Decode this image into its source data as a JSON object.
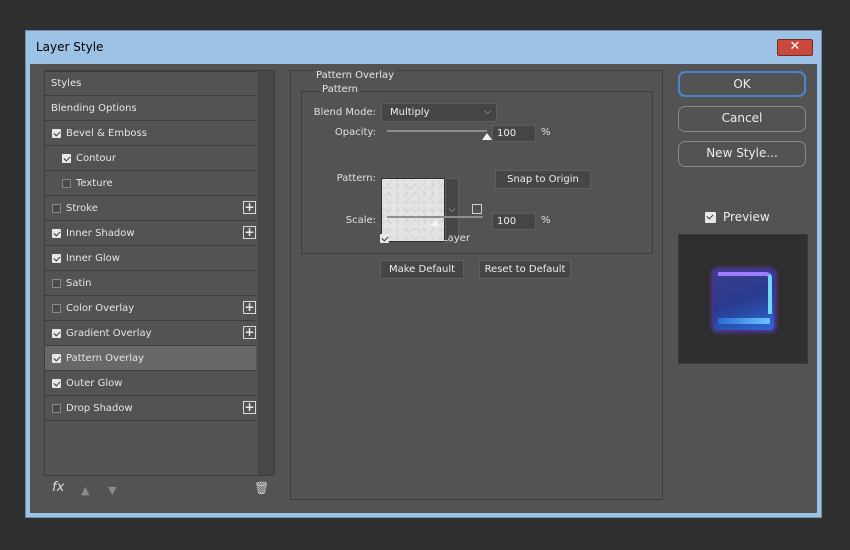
{
  "window": {
    "title": "Layer Style",
    "close_label": "✕"
  },
  "sidebar": {
    "items": [
      {
        "label": "Styles",
        "type": "header"
      },
      {
        "label": "Blending Options",
        "type": "header"
      },
      {
        "label": "Bevel & Emboss",
        "checked": true,
        "indent": 0,
        "plus": false
      },
      {
        "label": "Contour",
        "checked": true,
        "indent": 1,
        "plus": false
      },
      {
        "label": "Texture",
        "checked": false,
        "indent": 1,
        "plus": false
      },
      {
        "label": "Stroke",
        "checked": false,
        "indent": 0,
        "plus": true
      },
      {
        "label": "Inner Shadow",
        "checked": true,
        "indent": 0,
        "plus": true
      },
      {
        "label": "Inner Glow",
        "checked": true,
        "indent": 0,
        "plus": false
      },
      {
        "label": "Satin",
        "checked": false,
        "indent": 0,
        "plus": false
      },
      {
        "label": "Color Overlay",
        "checked": false,
        "indent": 0,
        "plus": true
      },
      {
        "label": "Gradient Overlay",
        "checked": true,
        "indent": 0,
        "plus": true
      },
      {
        "label": "Pattern Overlay",
        "checked": true,
        "indent": 0,
        "plus": false,
        "selected": true
      },
      {
        "label": "Outer Glow",
        "checked": true,
        "indent": 0,
        "plus": false
      },
      {
        "label": "Drop Shadow",
        "checked": false,
        "indent": 0,
        "plus": true
      }
    ],
    "footer": {
      "fx_label": "fx",
      "plus_glyph": "+"
    }
  },
  "pattern_overlay": {
    "group_title": "Pattern Overlay",
    "sub_title": "Pattern",
    "blend_mode_label": "Blend Mode:",
    "blend_mode_value": "Multiply",
    "opacity_label": "Opacity:",
    "opacity_value": "100",
    "opacity_unit": "%",
    "opacity_level": 1.0,
    "pattern_label": "Pattern:",
    "snap_to_origin_label": "Snap to Origin",
    "scale_label": "Scale:",
    "scale_value": "100",
    "scale_unit": "%",
    "scale_level": 0.5,
    "link_with_layer_label": "Link with Layer",
    "link_with_layer_checked": true,
    "make_default_label": "Make Default",
    "reset_to_default_label": "Reset to Default"
  },
  "actions": {
    "ok_label": "OK",
    "cancel_label": "Cancel",
    "new_style_label": "New Style...",
    "preview_label": "Preview",
    "preview_checked": true
  },
  "colors": {
    "dialog_bg": "#535353",
    "accent_blue": "#4a84d6",
    "title_bar": "#9cc3e6",
    "close_red": "#c94a3c"
  }
}
